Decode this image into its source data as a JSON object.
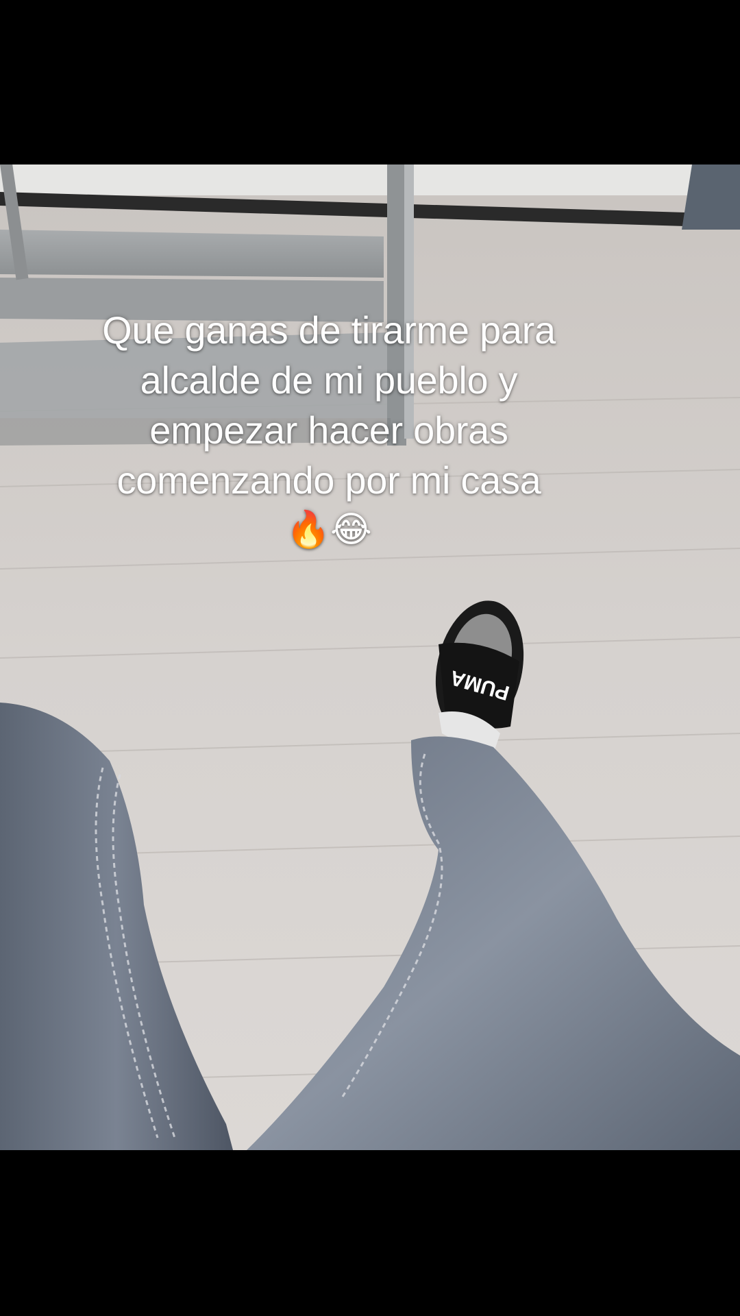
{
  "caption": {
    "lines": [
      "Que ganas de tirarme para",
      "alcalde de mi pueblo y",
      "empezar hacer obras",
      "comenzando por mi casa"
    ],
    "emojis": "🔥😂"
  },
  "photo": {
    "slide_logo": "PUMA"
  },
  "colors": {
    "background": "#000000",
    "floor": "#cfcac6",
    "denim": "#6e7785",
    "slide": "#141414",
    "caption_text": "#ffffff"
  }
}
